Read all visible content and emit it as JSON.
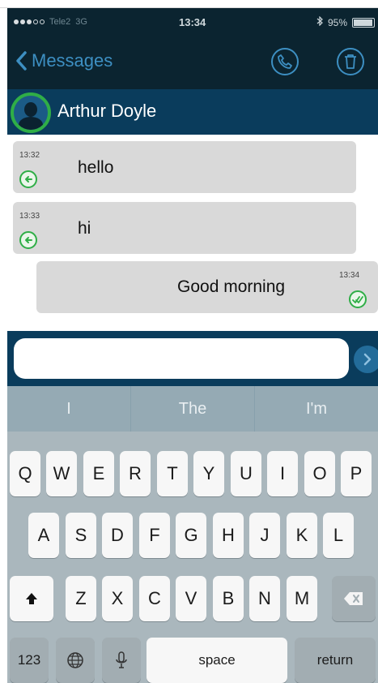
{
  "status": {
    "carrier": "Tele2",
    "network": "3G",
    "time": "13:34",
    "battery": "95%"
  },
  "nav": {
    "back_label": "Messages",
    "icons": [
      "phone-icon",
      "trash-icon"
    ]
  },
  "contact": {
    "name": "Arthur Doyle"
  },
  "messages": [
    {
      "time": "13:32",
      "text": "hello",
      "direction": "incoming"
    },
    {
      "time": "13:33",
      "text": "hi",
      "direction": "incoming"
    },
    {
      "time": "13:34",
      "text": "Good morning",
      "direction": "outgoing"
    }
  ],
  "composer": {
    "value": "",
    "placeholder": ""
  },
  "keyboard": {
    "suggestions": [
      "I",
      "The",
      "I'm"
    ],
    "row1": [
      "Q",
      "W",
      "E",
      "R",
      "T",
      "Y",
      "U",
      "I",
      "O",
      "P"
    ],
    "row2": [
      "A",
      "S",
      "D",
      "F",
      "G",
      "H",
      "J",
      "K",
      "L"
    ],
    "row3": [
      "Z",
      "X",
      "C",
      "V",
      "B",
      "N",
      "M"
    ],
    "numbers_label": "123",
    "space_label": "space",
    "return_label": "return"
  },
  "colors": {
    "nav_bg": "#0b2430",
    "contact_bg": "#0a3c5c",
    "accent": "#3d8fc2",
    "green": "#2fae47",
    "keyboard_bg": "#aab7bd"
  }
}
